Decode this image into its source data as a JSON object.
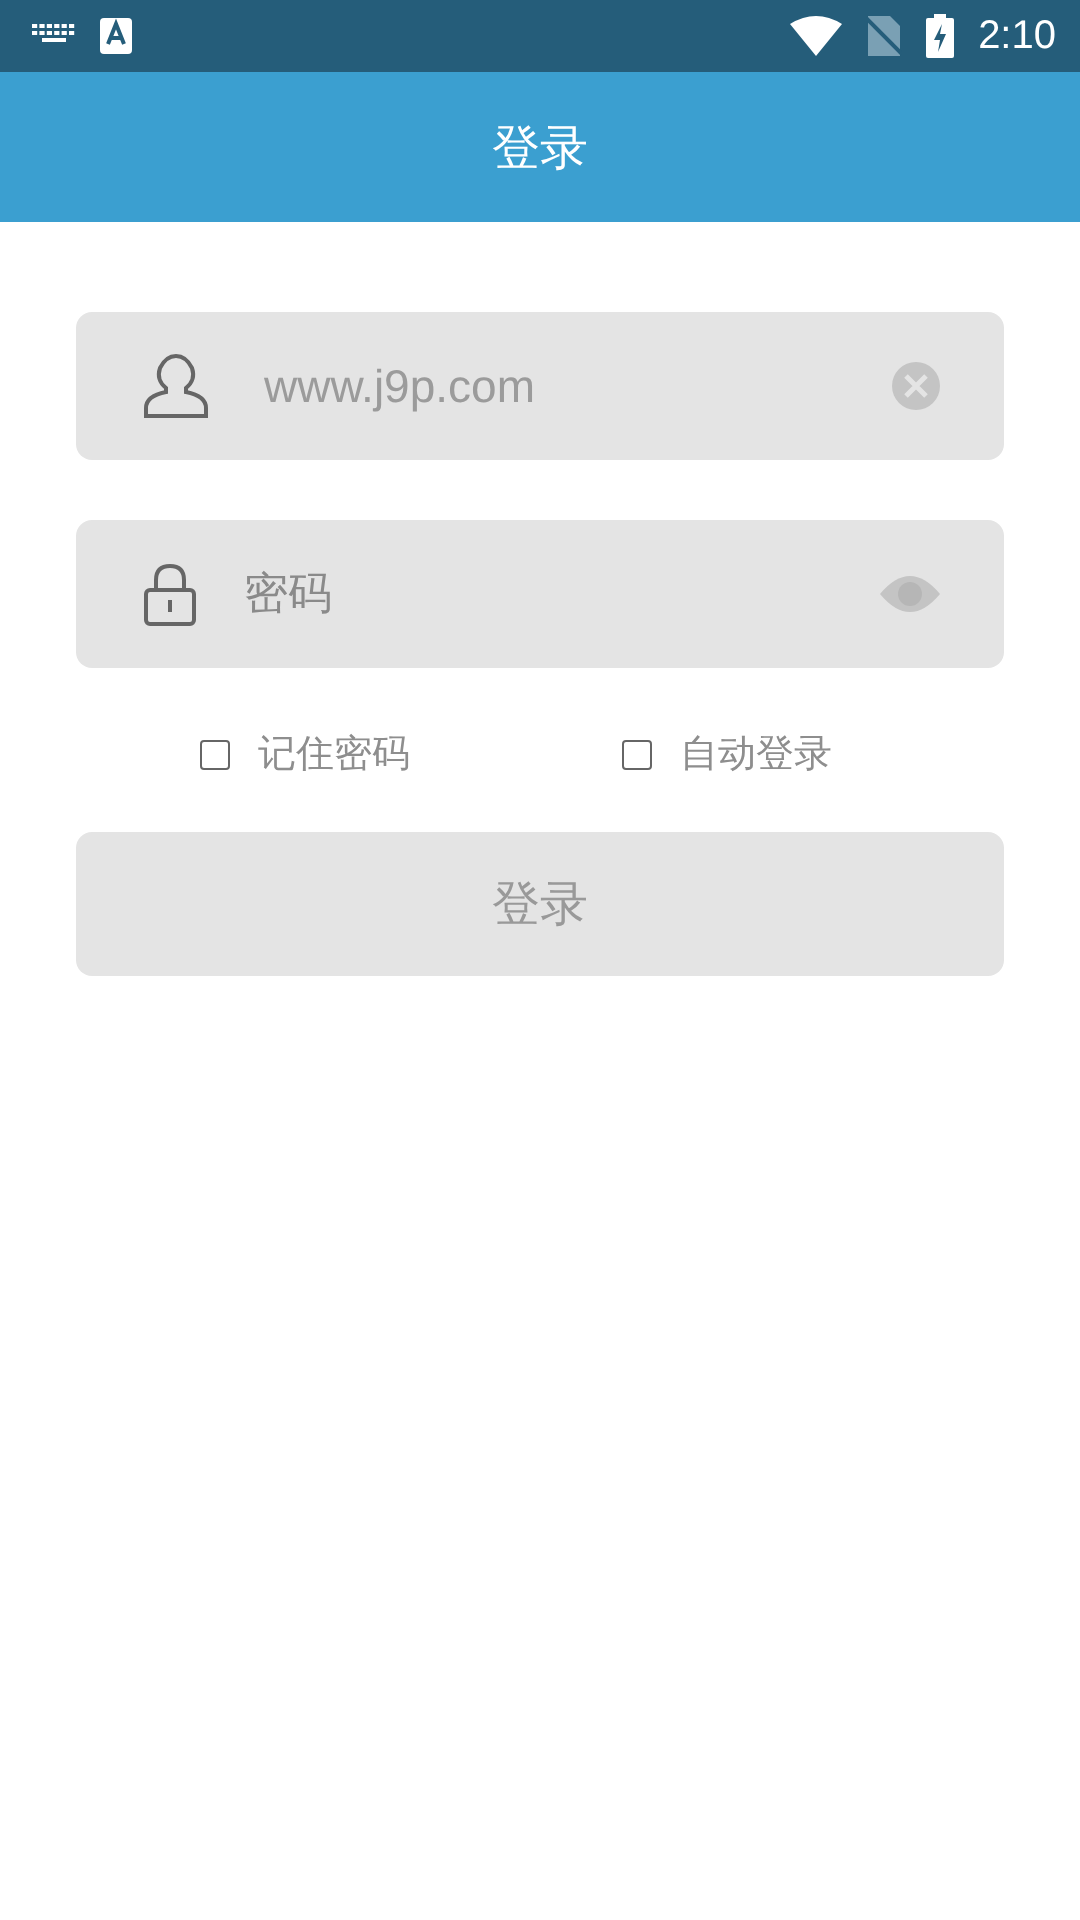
{
  "status_bar": {
    "time": "2:10"
  },
  "app_bar": {
    "title": "登录"
  },
  "username": {
    "value": "www.j9p.com"
  },
  "password": {
    "placeholder": "密码"
  },
  "options": [
    {
      "label": "记住密码",
      "checked": false
    },
    {
      "label": "自动登录",
      "checked": false
    }
  ],
  "login_button": {
    "label": "登录",
    "disabled": true
  }
}
